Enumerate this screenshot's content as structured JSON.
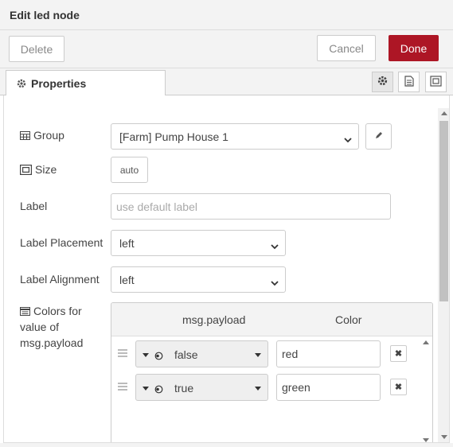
{
  "header": {
    "title": "Edit led node"
  },
  "toolbar": {
    "delete_label": "Delete",
    "cancel_label": "Cancel",
    "done_label": "Done"
  },
  "tabs": {
    "properties_label": "Properties",
    "icons": [
      "gear-icon",
      "description-icon",
      "appearance-icon"
    ]
  },
  "form": {
    "group": {
      "label": "Group",
      "value": "[Farm] Pump House 1"
    },
    "size": {
      "label": "Size",
      "value": "auto"
    },
    "label": {
      "label": "Label",
      "placeholder": "use default label"
    },
    "label_placement": {
      "label": "Label Placement",
      "value": "left"
    },
    "label_alignment": {
      "label": "Label Alignment",
      "value": "left"
    },
    "colors": {
      "label_lines": [
        "Colors for",
        "value of",
        "msg.payload"
      ],
      "col_payload": "msg.payload",
      "col_color": "Color",
      "rows": [
        {
          "payload": "false",
          "color": "red"
        },
        {
          "payload": "true",
          "color": "green"
        }
      ]
    }
  },
  "colors": {
    "accent": "#ad1625"
  }
}
